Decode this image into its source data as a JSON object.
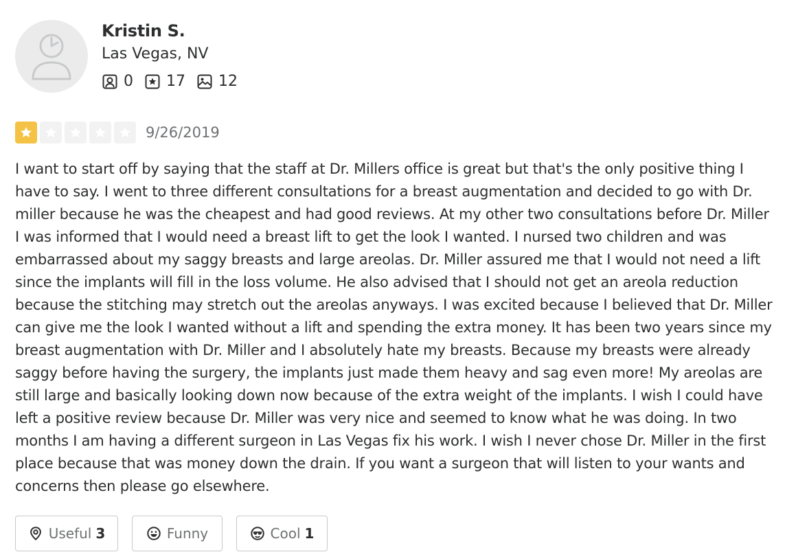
{
  "reviewer": {
    "name": "Kristin S.",
    "location": "Las Vegas, NV",
    "stats": {
      "friends": "0",
      "reviews": "17",
      "photos": "12"
    }
  },
  "review": {
    "rating": 1,
    "max_rating": 5,
    "date": "9/26/2019",
    "text": "I want to start off by saying that the staff at Dr. Millers office is great but that's the only positive thing I have to say. I went to three different consultations for a breast augmentation and decided to go with Dr. miller because he was the cheapest and had good reviews. At my other two consultations before Dr. Miller I was informed that I would need a breast lift to get the look I wanted. I nursed two children and was embarrassed about my saggy breasts and large areolas. Dr. Miller assured me that I would not need a lift since the implants will fill in the loss volume. He also advised that I should not get an areola reduction because the stitching may stretch out the areolas anyways. I was excited because I believed that Dr. Miller can give me the look I wanted without a lift and spending the extra money. It has been two years since my breast augmentation with Dr. Miller and I absolutely hate my breasts. Because my breasts were already saggy before having the surgery, the implants just made them heavy and sag even more! My areolas are still large and basically looking down now because of the extra weight of the implants. I wish I could have left a positive review because Dr. Miller was very nice and seemed to know what he was doing. In two months I am having a different surgeon in Las Vegas fix his work. I wish I never chose Dr. Miller in the first place because that was money down the drain. If you want a surgeon that will listen to your wants and concerns then please go elsewhere."
  },
  "reactions": {
    "useful": {
      "label": "Useful",
      "count": "3",
      "icon": "lightbulb-icon"
    },
    "funny": {
      "label": "Funny",
      "count": "",
      "icon": "smile-icon"
    },
    "cool": {
      "label": "Cool",
      "count": "1",
      "icon": "sunglasses-icon"
    }
  },
  "colors": {
    "star_filled": "#f4c244",
    "star_empty": "#f2f2f2",
    "text": "#2d2e2f",
    "muted": "#6e7072"
  }
}
